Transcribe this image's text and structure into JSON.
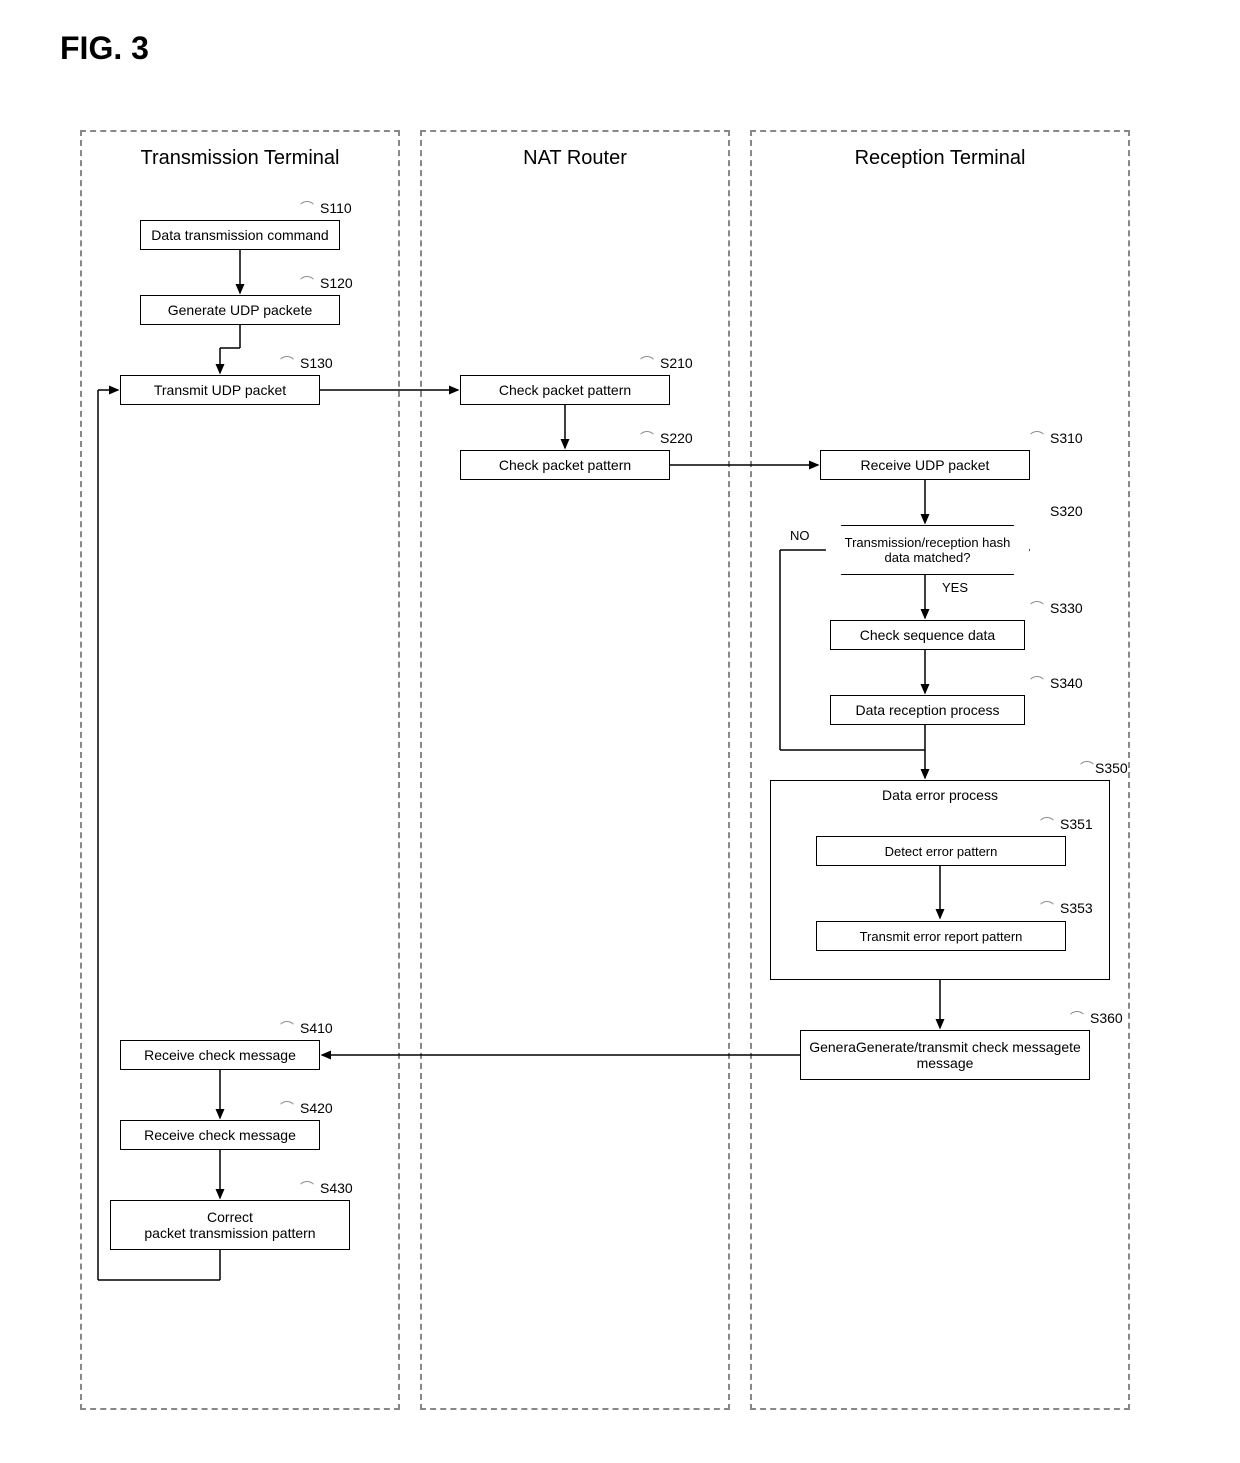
{
  "figure_label": "FIG. 3",
  "lanes": {
    "transmission": "Transmission Terminal",
    "nat": "NAT Router",
    "reception": "Reception Terminal"
  },
  "steps": {
    "s110": {
      "id": "S110",
      "text": "Data transmission command"
    },
    "s120": {
      "id": "S120",
      "text": "Generate UDP packete"
    },
    "s130": {
      "id": "S130",
      "text": "Transmit UDP packet"
    },
    "s210": {
      "id": "S210",
      "text": "Check packet pattern"
    },
    "s220": {
      "id": "S220",
      "text": "Check packet pattern"
    },
    "s310": {
      "id": "S310",
      "text": "Receive UDP packet"
    },
    "s320": {
      "id": "S320",
      "text": "Transmission/reception hash data matched?"
    },
    "s330": {
      "id": "S330",
      "text": "Check sequence data"
    },
    "s340": {
      "id": "S340",
      "text": "Data reception process"
    },
    "s350": {
      "id": "S350",
      "text": "Data error process"
    },
    "s351": {
      "id": "S351",
      "text": "Detect error pattern"
    },
    "s353": {
      "id": "S353",
      "text": "Transmit error report pattern"
    },
    "s360": {
      "id": "S360",
      "text": "GeneraGenerate/transmit check messagete message"
    },
    "s410": {
      "id": "S410",
      "text": "Receive check message"
    },
    "s420": {
      "id": "S420",
      "text": "Receive check message"
    },
    "s430": {
      "id": "S430",
      "text": "Correct\npacket transmission pattern"
    }
  },
  "edge_labels": {
    "no": "NO",
    "yes": "YES"
  }
}
